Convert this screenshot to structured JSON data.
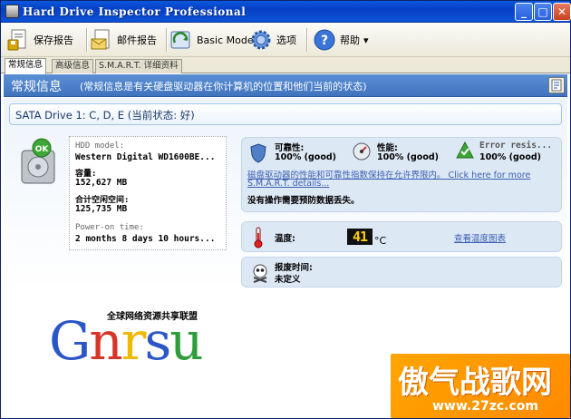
{
  "window": {
    "title": "Hard Drive Inspector Professional",
    "minimize": "_",
    "maximize": "□",
    "close": "✕"
  },
  "toolbar": {
    "save_report": "保存报告",
    "mail_report": "邮件报告",
    "basic_mode": "Basic Mode",
    "options": "选项",
    "help": "帮助",
    "help_arrow": "▾"
  },
  "tabs": [
    "常规信息",
    "高级信息",
    "S.M.A.R.T. 详细资料"
  ],
  "header": {
    "title": "常规信息",
    "subtitle": "(常规信息是有关硬盘驱动器在你计算机的位置和他们当前的状态)"
  },
  "drive": {
    "title": "SATA Drive 1: C, D, E (当前状态: 好)",
    "badge": "OK",
    "model_label": "HDD model:",
    "model_value": "Western Digital WD1600BE...",
    "capacity_label": "容量:",
    "capacity_value": "152,627 MB",
    "free_label": "合计空闲空间:",
    "free_value": "125,735 MB",
    "power_on_label": "Power-on time:",
    "power_on_value": "2 months 8 days 10 hours..."
  },
  "status": {
    "reliability_label": "可靠性:",
    "reliability_value": "100% (good)",
    "performance_label": "性能:",
    "performance_value": "100% (good)",
    "errors_label": "Error resis...",
    "errors_value": "100% (good)",
    "note": "磁盘驱动器的性能和可靠性指数保持在允许界限内。 Click here for more",
    "note_link": "S.M.A.R.T. details...",
    "summary": "没有操作需要预防数据丢失。"
  },
  "temperature": {
    "label": "温度:",
    "value": "41",
    "unit": "°C",
    "chart_link": "查看温度图表"
  },
  "failure": {
    "label": "报废时间:",
    "value": "未定义"
  },
  "watermark": {
    "caption": "全球网络资源共享联盟",
    "letters": [
      "G",
      "n",
      "r",
      "s",
      "u"
    ],
    "colors": [
      "#2b56c7",
      "#d8352a",
      "#f2b800",
      "#2b56c7",
      "#2e9d3a"
    ],
    "corner_text": "傲气战歌网",
    "corner_url": "www.27zc.com"
  }
}
